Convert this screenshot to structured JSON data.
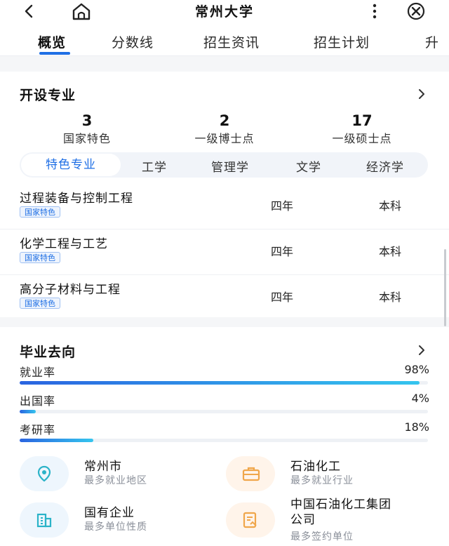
{
  "header": {
    "title": "常州大学"
  },
  "tabs": [
    {
      "label": "概览",
      "active": true
    },
    {
      "label": "分数线"
    },
    {
      "label": "招生资讯"
    },
    {
      "label": "招生计划"
    },
    {
      "label": "升"
    }
  ],
  "majors_section": {
    "title": "开设专业",
    "stats": [
      {
        "value": "3",
        "label": "国家特色"
      },
      {
        "value": "2",
        "label": "一级博士点"
      },
      {
        "value": "17",
        "label": "一级硕士点"
      }
    ],
    "categories": [
      "特色专业",
      "工学",
      "管理学",
      "文学",
      "经济学"
    ],
    "rows": [
      {
        "name": "过程装备与控制工程",
        "badge": "国家特色",
        "years": "四年",
        "level": "本科"
      },
      {
        "name": "化学工程与工艺",
        "badge": "国家特色",
        "years": "四年",
        "level": "本科"
      },
      {
        "name": "高分子材料与工程",
        "badge": "国家特色",
        "years": "四年",
        "level": "本科"
      }
    ]
  },
  "employment_section": {
    "title": "毕业去向",
    "rates": [
      {
        "label": "就业率",
        "value": "98%",
        "fraction": 0.98
      },
      {
        "label": "出国率",
        "value": "4%",
        "fraction": 0.04
      },
      {
        "label": "考研率",
        "value": "18%",
        "fraction": 0.18
      }
    ],
    "destinations": [
      {
        "title": "常州市",
        "subtitle": "最多就业地区",
        "icon": "location-pin-icon"
      },
      {
        "title": "石油化工",
        "subtitle": "最多就业行业",
        "icon": "briefcase-icon"
      },
      {
        "title": "国有企业",
        "subtitle": "最多单位性质",
        "icon": "building-icon"
      },
      {
        "title": "中国石油化工集团公司",
        "title_line1": "中国石油化工集团",
        "title_line2": "公司",
        "subtitle": "最多签约单位",
        "icon": "contract-icon"
      }
    ]
  },
  "colors": {
    "accent": "#1f6fe5",
    "bar_start": "#2a64e0",
    "bar_end": "#35c5ee",
    "icon_warm": "#f0a64a",
    "icon_teal": "#2bb3c8"
  }
}
